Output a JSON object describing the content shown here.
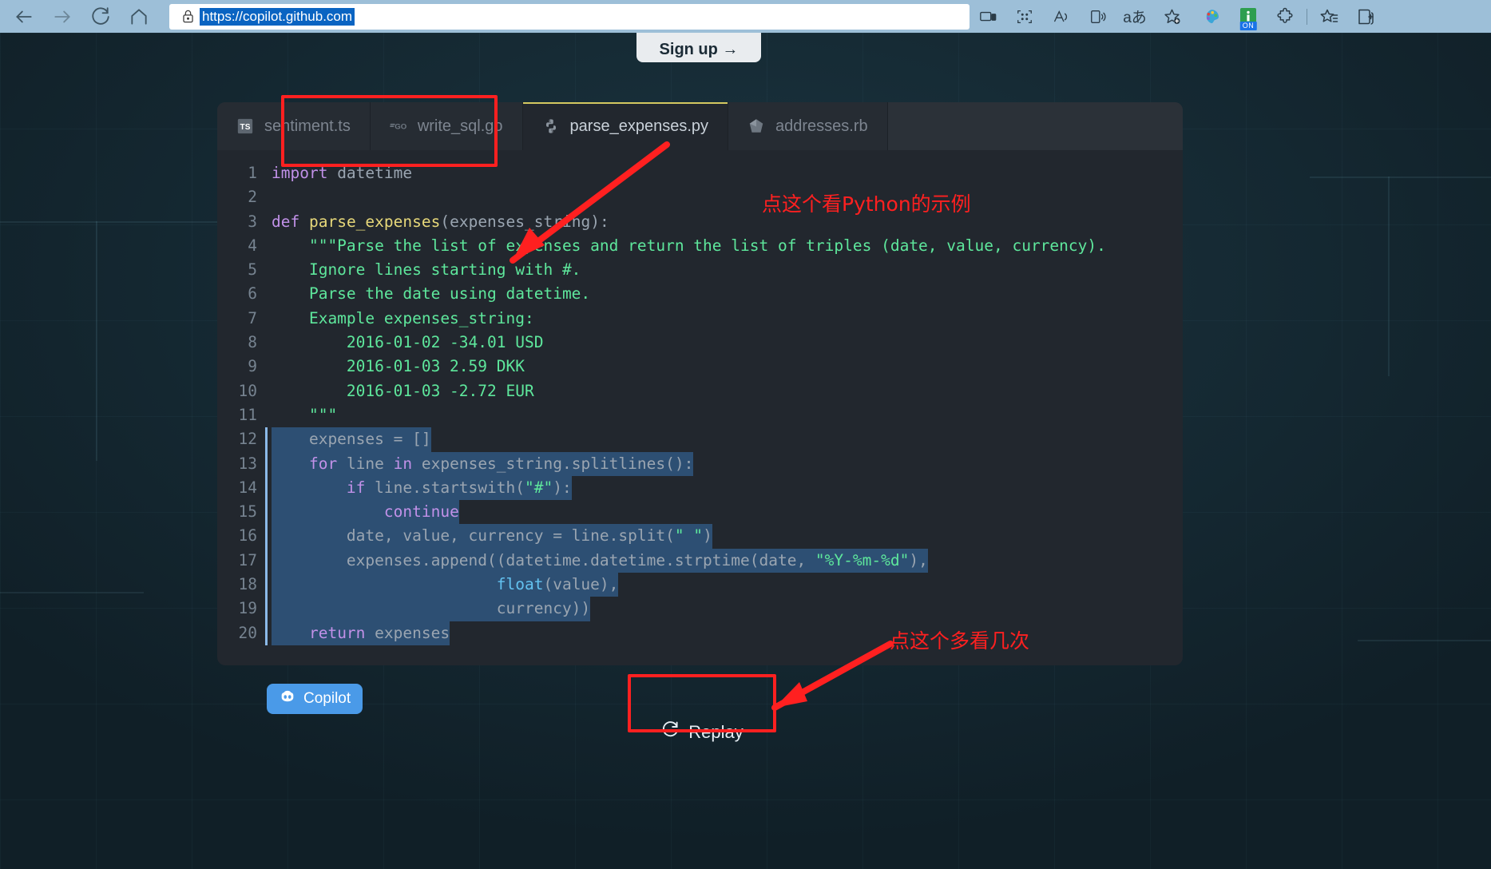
{
  "browser": {
    "url": "https://copilot.github.com",
    "url_selected": true,
    "nav": [
      {
        "name": "back-button",
        "glyph": "back"
      },
      {
        "name": "forward-button",
        "glyph": "forward"
      },
      {
        "name": "refresh-button",
        "glyph": "refresh"
      },
      {
        "name": "home-button",
        "glyph": "home"
      }
    ],
    "lock_icon": "lock-icon",
    "toolbar_icons": [
      "device-cast-icon",
      "qr-code-icon",
      "read-aloud-icon",
      "immersive-reader-icon",
      "translate-icon",
      "add-favorite-icon"
    ],
    "extension_icons": [
      "color-palette-extension-icon",
      "info-on-extension-icon",
      "puzzle-extensions-icon",
      "favorites-icon",
      "collections-icon"
    ],
    "extension_badge": "ON"
  },
  "page": {
    "signup_label": "Sign up →"
  },
  "editor": {
    "tabs": [
      {
        "label": "sentiment.ts",
        "icon": "typescript-file-icon",
        "active": false
      },
      {
        "label": "write_sql.go",
        "icon": "go-file-icon",
        "active": false
      },
      {
        "label": "parse_expenses.py",
        "icon": "python-file-icon",
        "active": true
      },
      {
        "label": "addresses.rb",
        "icon": "ruby-file-icon",
        "active": false
      }
    ],
    "active_tab": "parse_expenses.py",
    "copilot_badge": "Copilot",
    "replay_label": "Replay",
    "replay_icon": "refresh-icon",
    "colors": {
      "panel_bg": "#22272e",
      "selection": "#2d4f73",
      "selection_border": "#8bb9e8",
      "active_tab_underline": "#d4c860",
      "keyword": "#c191e8",
      "function": "#e7d87a",
      "string": "#5ee79c",
      "builtin": "#63c2f0",
      "plain": "#9aa5b1",
      "line_number": "#768390",
      "copilot_badge": "#4a9ae8",
      "annotation": "#ff2020"
    },
    "lines": [
      {
        "n": 1,
        "selected": false,
        "tokens": [
          {
            "t": "import",
            "c": "kw"
          },
          {
            "t": " datetime",
            "c": "pln"
          }
        ]
      },
      {
        "n": 2,
        "selected": false,
        "tokens": []
      },
      {
        "n": 3,
        "selected": false,
        "tokens": [
          {
            "t": "def",
            "c": "kw"
          },
          {
            "t": " ",
            "c": "pln"
          },
          {
            "t": "parse_expenses",
            "c": "fn"
          },
          {
            "t": "(expenses_string):",
            "c": "pln"
          }
        ]
      },
      {
        "n": 4,
        "selected": false,
        "tokens": [
          {
            "t": "    \"\"\"Parse the list of expenses and return the list of triples (date, value, currency).",
            "c": "doc"
          }
        ]
      },
      {
        "n": 5,
        "selected": false,
        "tokens": [
          {
            "t": "    Ignore lines starting with #.",
            "c": "doc"
          }
        ]
      },
      {
        "n": 6,
        "selected": false,
        "tokens": [
          {
            "t": "    Parse the date using datetime.",
            "c": "doc"
          }
        ]
      },
      {
        "n": 7,
        "selected": false,
        "tokens": [
          {
            "t": "    Example expenses_string:",
            "c": "doc"
          }
        ]
      },
      {
        "n": 8,
        "selected": false,
        "tokens": [
          {
            "t": "        2016-01-02 -34.01 USD",
            "c": "doc"
          }
        ]
      },
      {
        "n": 9,
        "selected": false,
        "tokens": [
          {
            "t": "        2016-01-03 2.59 DKK",
            "c": "doc"
          }
        ]
      },
      {
        "n": 10,
        "selected": false,
        "tokens": [
          {
            "t": "        2016-01-03 -2.72 EUR",
            "c": "doc"
          }
        ]
      },
      {
        "n": 11,
        "selected": false,
        "tokens": [
          {
            "t": "    \"\"\"",
            "c": "doc"
          }
        ]
      },
      {
        "n": 12,
        "selected": true,
        "tokens": [
          {
            "t": "    expenses = []",
            "c": "pln"
          }
        ]
      },
      {
        "n": 13,
        "selected": true,
        "tokens": [
          {
            "t": "    ",
            "c": "pln"
          },
          {
            "t": "for",
            "c": "kw"
          },
          {
            "t": " line ",
            "c": "pln"
          },
          {
            "t": "in",
            "c": "kw"
          },
          {
            "t": " expenses_string.splitlines():",
            "c": "pln"
          }
        ]
      },
      {
        "n": 14,
        "selected": true,
        "tokens": [
          {
            "t": "        ",
            "c": "pln"
          },
          {
            "t": "if",
            "c": "kw"
          },
          {
            "t": " line.startswith(",
            "c": "pln"
          },
          {
            "t": "\"#\"",
            "c": "str"
          },
          {
            "t": "):",
            "c": "pln"
          }
        ]
      },
      {
        "n": 15,
        "selected": true,
        "tokens": [
          {
            "t": "            ",
            "c": "pln"
          },
          {
            "t": "continue",
            "c": "kw"
          }
        ]
      },
      {
        "n": 16,
        "selected": true,
        "tokens": [
          {
            "t": "        date, value, currency = line.split(",
            "c": "pln"
          },
          {
            "t": "\" \"",
            "c": "str"
          },
          {
            "t": ")",
            "c": "pln"
          }
        ]
      },
      {
        "n": 17,
        "selected": true,
        "tokens": [
          {
            "t": "        expenses.append((datetime.datetime.strptime(date, ",
            "c": "pln"
          },
          {
            "t": "\"%Y-%m-%d\"",
            "c": "str"
          },
          {
            "t": "),",
            "c": "pln"
          }
        ]
      },
      {
        "n": 18,
        "selected": true,
        "tokens": [
          {
            "t": "                        ",
            "c": "pln"
          },
          {
            "t": "float",
            "c": "bi"
          },
          {
            "t": "(value),",
            "c": "pln"
          }
        ]
      },
      {
        "n": 19,
        "selected": true,
        "tokens": [
          {
            "t": "                        currency))",
            "c": "pln"
          }
        ]
      },
      {
        "n": 20,
        "selected": true,
        "tokens": [
          {
            "t": "    ",
            "c": "pln"
          },
          {
            "t": "return",
            "c": "kw"
          },
          {
            "t": " expenses",
            "c": "pln"
          }
        ]
      }
    ]
  },
  "annotations": {
    "tab_note": "点这个看Python的示例",
    "replay_note": "点这个多看几次"
  }
}
